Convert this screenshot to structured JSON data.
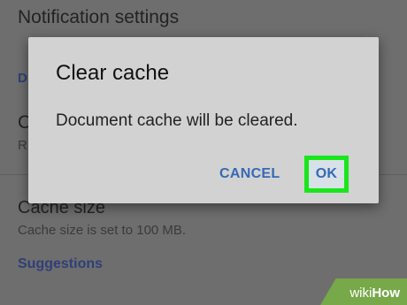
{
  "background": {
    "notification_settings": "Notification settings",
    "section_letter": "D",
    "item_letter": "C",
    "item_sub_letter": "R",
    "cache_size_title": "Cache size",
    "cache_size_subtitle": "Cache size is set to 100 MB.",
    "suggestions_header": "Suggestions"
  },
  "dialog": {
    "title": "Clear cache",
    "message": "Document cache will be cleared.",
    "cancel_label": "CANCEL",
    "ok_label": "OK"
  },
  "watermark": {
    "prefix": "wiki",
    "suffix": "How"
  },
  "colors": {
    "accent": "#3569b5",
    "highlight": "#19e61b",
    "dialog_bg": "#d2d2d2",
    "scrim": "#6e6e6e"
  }
}
